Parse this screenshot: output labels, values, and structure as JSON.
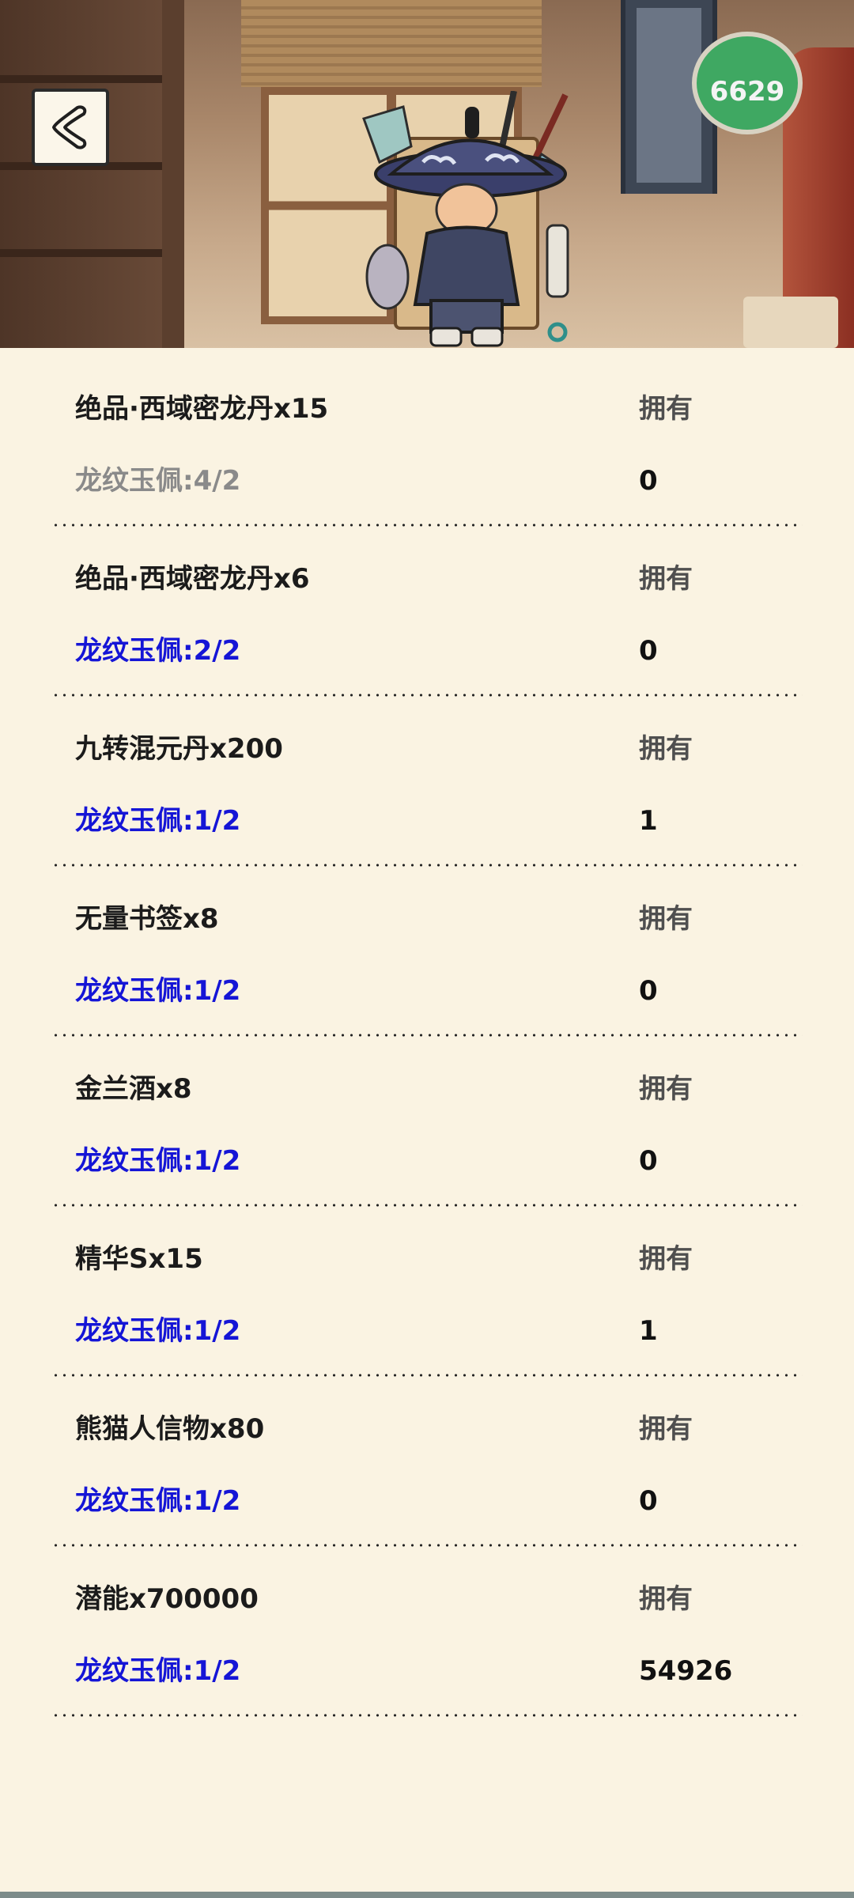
{
  "header": {
    "badge_text": "6629",
    "back_icon": "chevron-left-icon"
  },
  "items": [
    {
      "title": "绝品·西域密龙丹x15",
      "progress": "龙纹玉佩:4/2",
      "owned_label": "拥有",
      "owned_value": "0",
      "status": "muted"
    },
    {
      "title": "绝品·西域密龙丹x6",
      "progress": "龙纹玉佩:2/2",
      "owned_label": "拥有",
      "owned_value": "0",
      "status": "active"
    },
    {
      "title": "九转混元丹x200",
      "progress": "龙纹玉佩:1/2",
      "owned_label": "拥有",
      "owned_value": "1",
      "status": "active"
    },
    {
      "title": "无量书签x8",
      "progress": "龙纹玉佩:1/2",
      "owned_label": "拥有",
      "owned_value": "0",
      "status": "active"
    },
    {
      "title": "金兰酒x8",
      "progress": "龙纹玉佩:1/2",
      "owned_label": "拥有",
      "owned_value": "0",
      "status": "active"
    },
    {
      "title": "精华Sx15",
      "progress": "龙纹玉佩:1/2",
      "owned_label": "拥有",
      "owned_value": "1",
      "status": "active"
    },
    {
      "title": "熊猫人信物x80",
      "progress": "龙纹玉佩:1/2",
      "owned_label": "拥有",
      "owned_value": "0",
      "status": "active"
    },
    {
      "title": "潜能x700000",
      "progress": "龙纹玉佩:1/2",
      "owned_label": "拥有",
      "owned_value": "54926",
      "status": "active"
    }
  ],
  "colors": {
    "background": "#faf3e2",
    "progress_active": "#1515d6",
    "progress_muted": "#8a8a8a",
    "badge": "#3fa862"
  }
}
